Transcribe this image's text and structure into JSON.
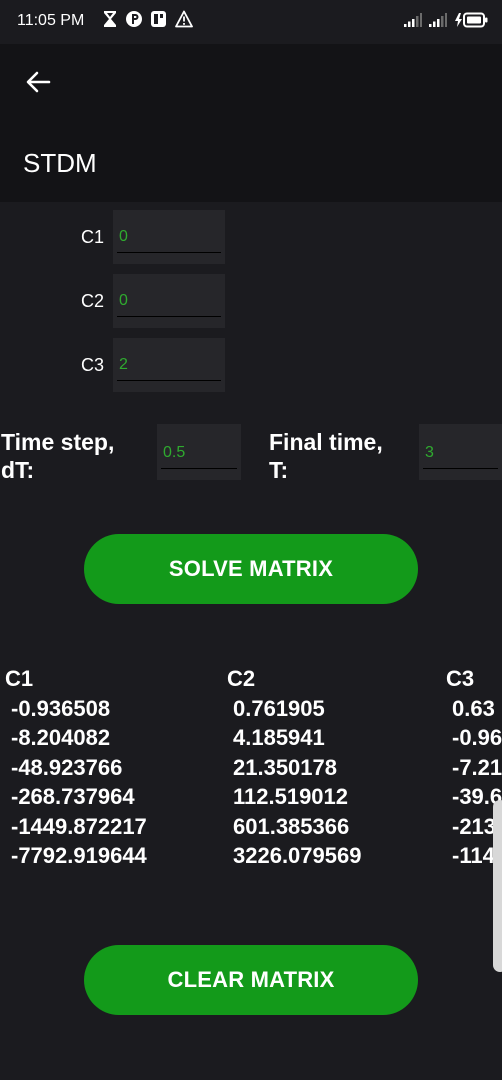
{
  "status_bar": {
    "time": "11:05 PM",
    "left_icons": [
      "hourglass-icon",
      "parking-app-icon",
      "gallery-app-icon",
      "warning-icon"
    ],
    "right_icons": [
      "signal-icon",
      "signal-icon",
      "battery-charging-icon"
    ]
  },
  "app_bar": {
    "back_icon": "arrow-left-icon",
    "title": "STDM"
  },
  "inputs": {
    "c1": {
      "label": "C1",
      "value": "0"
    },
    "c2": {
      "label": "C2",
      "value": "0"
    },
    "c3": {
      "label": "C3",
      "value": "2"
    }
  },
  "params": {
    "time_step_label_line1": "Time step,",
    "time_step_label_line2": "dT:",
    "time_step_value": "0.5",
    "final_time_label_line1": "Final time,",
    "final_time_label_line2": "T:",
    "final_time_value": "3"
  },
  "buttons": {
    "solve": "SOLVE MATRIX",
    "clear": "CLEAR MATRIX"
  },
  "results": {
    "columns": [
      {
        "header": "C1",
        "values": [
          "-0.936508",
          "-8.204082",
          "-48.923766",
          "-268.737964",
          "-1449.872217",
          "-7792.919644"
        ]
      },
      {
        "header": "C2",
        "values": [
          "0.761905",
          "4.185941",
          "21.350178",
          "112.519012",
          "601.385366",
          "3226.079569"
        ]
      },
      {
        "header": "C3",
        "values": [
          "0.63",
          "-0.96",
          "-7.21",
          "-39.6",
          "-213",
          "-114"
        ]
      }
    ]
  },
  "colors": {
    "accent_green": "#139a1a",
    "input_text_green": "#2faa2f",
    "background": "#1b1b1f",
    "app_bar": "#131316"
  }
}
